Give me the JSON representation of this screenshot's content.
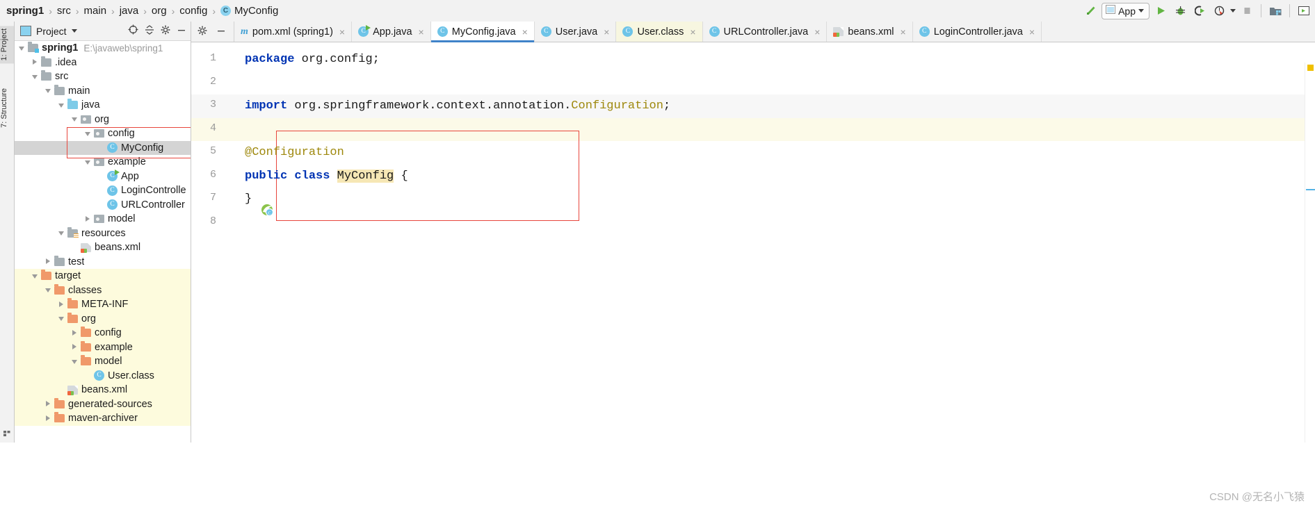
{
  "breadcrumb": {
    "items": [
      "spring1",
      "src",
      "main",
      "java",
      "org",
      "config",
      "MyConfig"
    ],
    "separator": "›",
    "class_badge": "C"
  },
  "toolbar": {
    "build_icon": "hammer-icon",
    "run_config_label": "App",
    "run_config_icon": "app-window-icon",
    "run_label": "Run",
    "debug_label": "Debug",
    "run_coverage_label": "Run with Coverage",
    "profiler_label": "Profiler",
    "stop_label": "Stop",
    "project_structure_label": "Project Structure",
    "console_label": "Console"
  },
  "left_strip": {
    "project_tab": "1: Project",
    "structure_tab": "7: Structure"
  },
  "project_panel": {
    "title": "Project",
    "locate_icon": "crosshair-icon",
    "collapse_icon": "collapse-all-icon",
    "settings_icon": "gear-icon",
    "hide_icon": "minimize-icon",
    "tree": [
      {
        "label": "spring1",
        "path": "E:\\javaweb\\spring1",
        "indent": 0,
        "arrow": "open",
        "icon": "module",
        "bold": true
      },
      {
        "label": ".idea",
        "indent": 1,
        "arrow": "closed",
        "icon": "gray"
      },
      {
        "label": "src",
        "indent": 1,
        "arrow": "open",
        "icon": "gray"
      },
      {
        "label": "main",
        "indent": 2,
        "arrow": "open",
        "icon": "gray"
      },
      {
        "label": "java",
        "indent": 3,
        "arrow": "open",
        "icon": "blue"
      },
      {
        "label": "org",
        "indent": 4,
        "arrow": "open",
        "icon": "pkg"
      },
      {
        "label": "config",
        "indent": 5,
        "arrow": "open",
        "icon": "pkg"
      },
      {
        "label": "MyConfig",
        "indent": 6,
        "arrow": "none",
        "icon": "class",
        "selected": true
      },
      {
        "label": "example",
        "indent": 5,
        "arrow": "open",
        "icon": "pkg"
      },
      {
        "label": "App",
        "indent": 6,
        "arrow": "none",
        "icon": "class-runnable"
      },
      {
        "label": "LoginControlle",
        "indent": 6,
        "arrow": "none",
        "icon": "class"
      },
      {
        "label": "URLController",
        "indent": 6,
        "arrow": "none",
        "icon": "class"
      },
      {
        "label": "model",
        "indent": 5,
        "arrow": "closed",
        "icon": "pkg"
      },
      {
        "label": "resources",
        "indent": 3,
        "arrow": "open",
        "icon": "res"
      },
      {
        "label": "beans.xml",
        "indent": 4,
        "arrow": "none",
        "icon": "xml"
      },
      {
        "label": "test",
        "indent": 2,
        "arrow": "closed",
        "icon": "gray"
      },
      {
        "label": "target",
        "indent": 1,
        "arrow": "open",
        "icon": "orange",
        "excluded": true
      },
      {
        "label": "classes",
        "indent": 2,
        "arrow": "open",
        "icon": "orange",
        "excluded": true
      },
      {
        "label": "META-INF",
        "indent": 3,
        "arrow": "closed",
        "icon": "orange",
        "excluded": true
      },
      {
        "label": "org",
        "indent": 3,
        "arrow": "open",
        "icon": "orange",
        "excluded": true
      },
      {
        "label": "config",
        "indent": 4,
        "arrow": "closed",
        "icon": "orange",
        "excluded": true
      },
      {
        "label": "example",
        "indent": 4,
        "arrow": "closed",
        "icon": "orange",
        "excluded": true
      },
      {
        "label": "model",
        "indent": 4,
        "arrow": "open",
        "icon": "orange",
        "excluded": true
      },
      {
        "label": "User.class",
        "indent": 5,
        "arrow": "none",
        "icon": "class",
        "excluded": true
      },
      {
        "label": "beans.xml",
        "indent": 3,
        "arrow": "none",
        "icon": "xml",
        "excluded": true
      },
      {
        "label": "generated-sources",
        "indent": 2,
        "arrow": "closed",
        "icon": "orange",
        "excluded": true
      },
      {
        "label": "maven-archiver",
        "indent": 2,
        "arrow": "closed",
        "icon": "orange",
        "excluded": true
      }
    ]
  },
  "editor": {
    "tab_tools": {
      "settings_icon": "gear-icon",
      "hide_icon": "minimize-icon"
    },
    "tabs": [
      {
        "label": "pom.xml (spring1)",
        "icon": "maven-icon",
        "state": "normal",
        "close": "×"
      },
      {
        "label": "App.java",
        "icon": "class-runnable-icon",
        "state": "normal",
        "close": "×"
      },
      {
        "label": "MyConfig.java",
        "icon": "class-icon",
        "state": "active",
        "close": "×"
      },
      {
        "label": "User.java",
        "icon": "class-icon",
        "state": "normal",
        "close": "×"
      },
      {
        "label": "User.class",
        "icon": "class-icon",
        "state": "highlighted",
        "close": "×"
      },
      {
        "label": "URLController.java",
        "icon": "class-icon",
        "state": "normal",
        "close": "×"
      },
      {
        "label": "beans.xml",
        "icon": "xml-icon",
        "state": "normal",
        "close": "×"
      },
      {
        "label": "LoginController.java",
        "icon": "class-icon",
        "state": "normal",
        "close": "×"
      }
    ],
    "line_numbers": [
      "1",
      "2",
      "3",
      "4",
      "5",
      "6",
      "7",
      "8"
    ],
    "code_lines": [
      {
        "n": 1,
        "segments": [
          {
            "t": "package",
            "c": "k"
          },
          {
            "t": " org.config;",
            "c": ""
          }
        ]
      },
      {
        "n": 2,
        "segments": []
      },
      {
        "n": 3,
        "segments": [
          {
            "t": "import",
            "c": "k"
          },
          {
            "t": " org.springframework.context.annotation.",
            "c": ""
          },
          {
            "t": "Configuration",
            "c": "ann"
          },
          {
            "t": ";",
            "c": ""
          }
        ]
      },
      {
        "n": 4,
        "segments": []
      },
      {
        "n": 5,
        "segments": [
          {
            "t": "@Configuration",
            "c": "ann"
          }
        ]
      },
      {
        "n": 6,
        "segments": [
          {
            "t": "public class",
            "c": "k"
          },
          {
            "t": " ",
            "c": ""
          },
          {
            "t": "MyConfig",
            "c": "hlw"
          },
          {
            "t": " {",
            "c": ""
          }
        ]
      },
      {
        "n": 7,
        "segments": [
          {
            "t": "}",
            "c": ""
          }
        ]
      },
      {
        "n": 8,
        "segments": []
      }
    ],
    "bean_gutter_icon": "spring-bean-icon",
    "warning_marker": "warning-marker",
    "annotation_color": "#9e880d",
    "keyword_color": "#0033b3",
    "highlight_color": "#f6e7b5",
    "accent_color": "#4083c9",
    "redbox_color": "#e8453c"
  },
  "watermark": "CSDN @无名小飞猿"
}
